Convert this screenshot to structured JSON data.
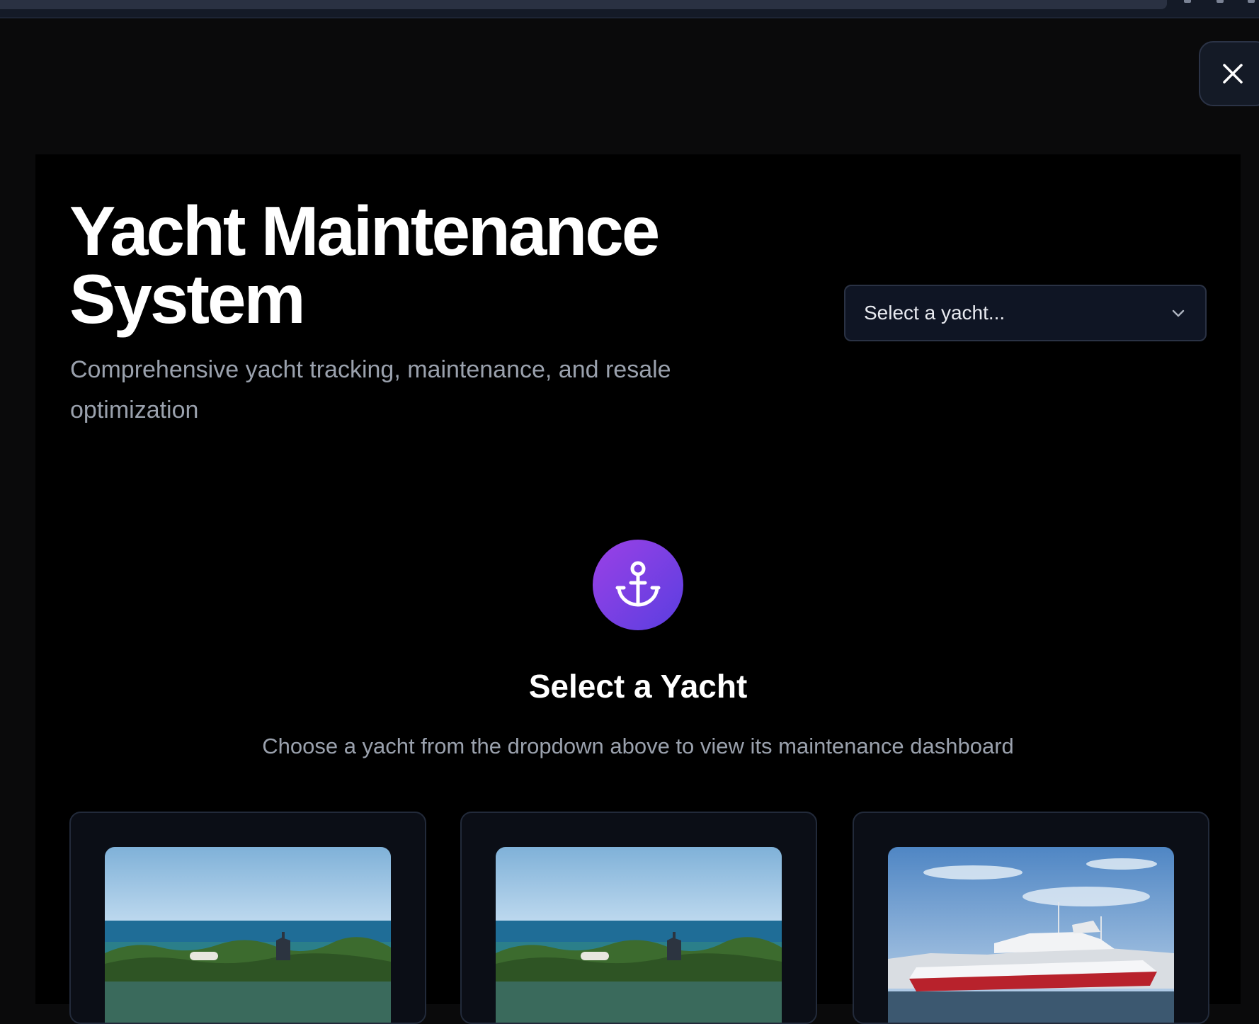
{
  "close_button": {
    "icon": "close-icon"
  },
  "header": {
    "title": "Yacht Maintenance System",
    "subtitle": "Comprehensive yacht tracking, maintenance, and resale optimization"
  },
  "yacht_select": {
    "value": "Select a yacht...",
    "icon": "chevron-down-icon"
  },
  "empty_state": {
    "icon": "anchor-icon",
    "title": "Select a Yacht",
    "description": "Choose a yacht from the dropdown above to view its maintenance dashboard"
  },
  "yacht_cards": [
    {
      "image": "yacht-photo-tropical-harbor"
    },
    {
      "image": "yacht-photo-tropical-harbor"
    },
    {
      "image": "yacht-photo-marina"
    }
  ],
  "colors": {
    "background": "#0a0a0b",
    "panel": "#000000",
    "accent_gradient_start": "#9b41e6",
    "accent_gradient_end": "#5a3ee0",
    "muted_text": "#9aa1ad"
  }
}
